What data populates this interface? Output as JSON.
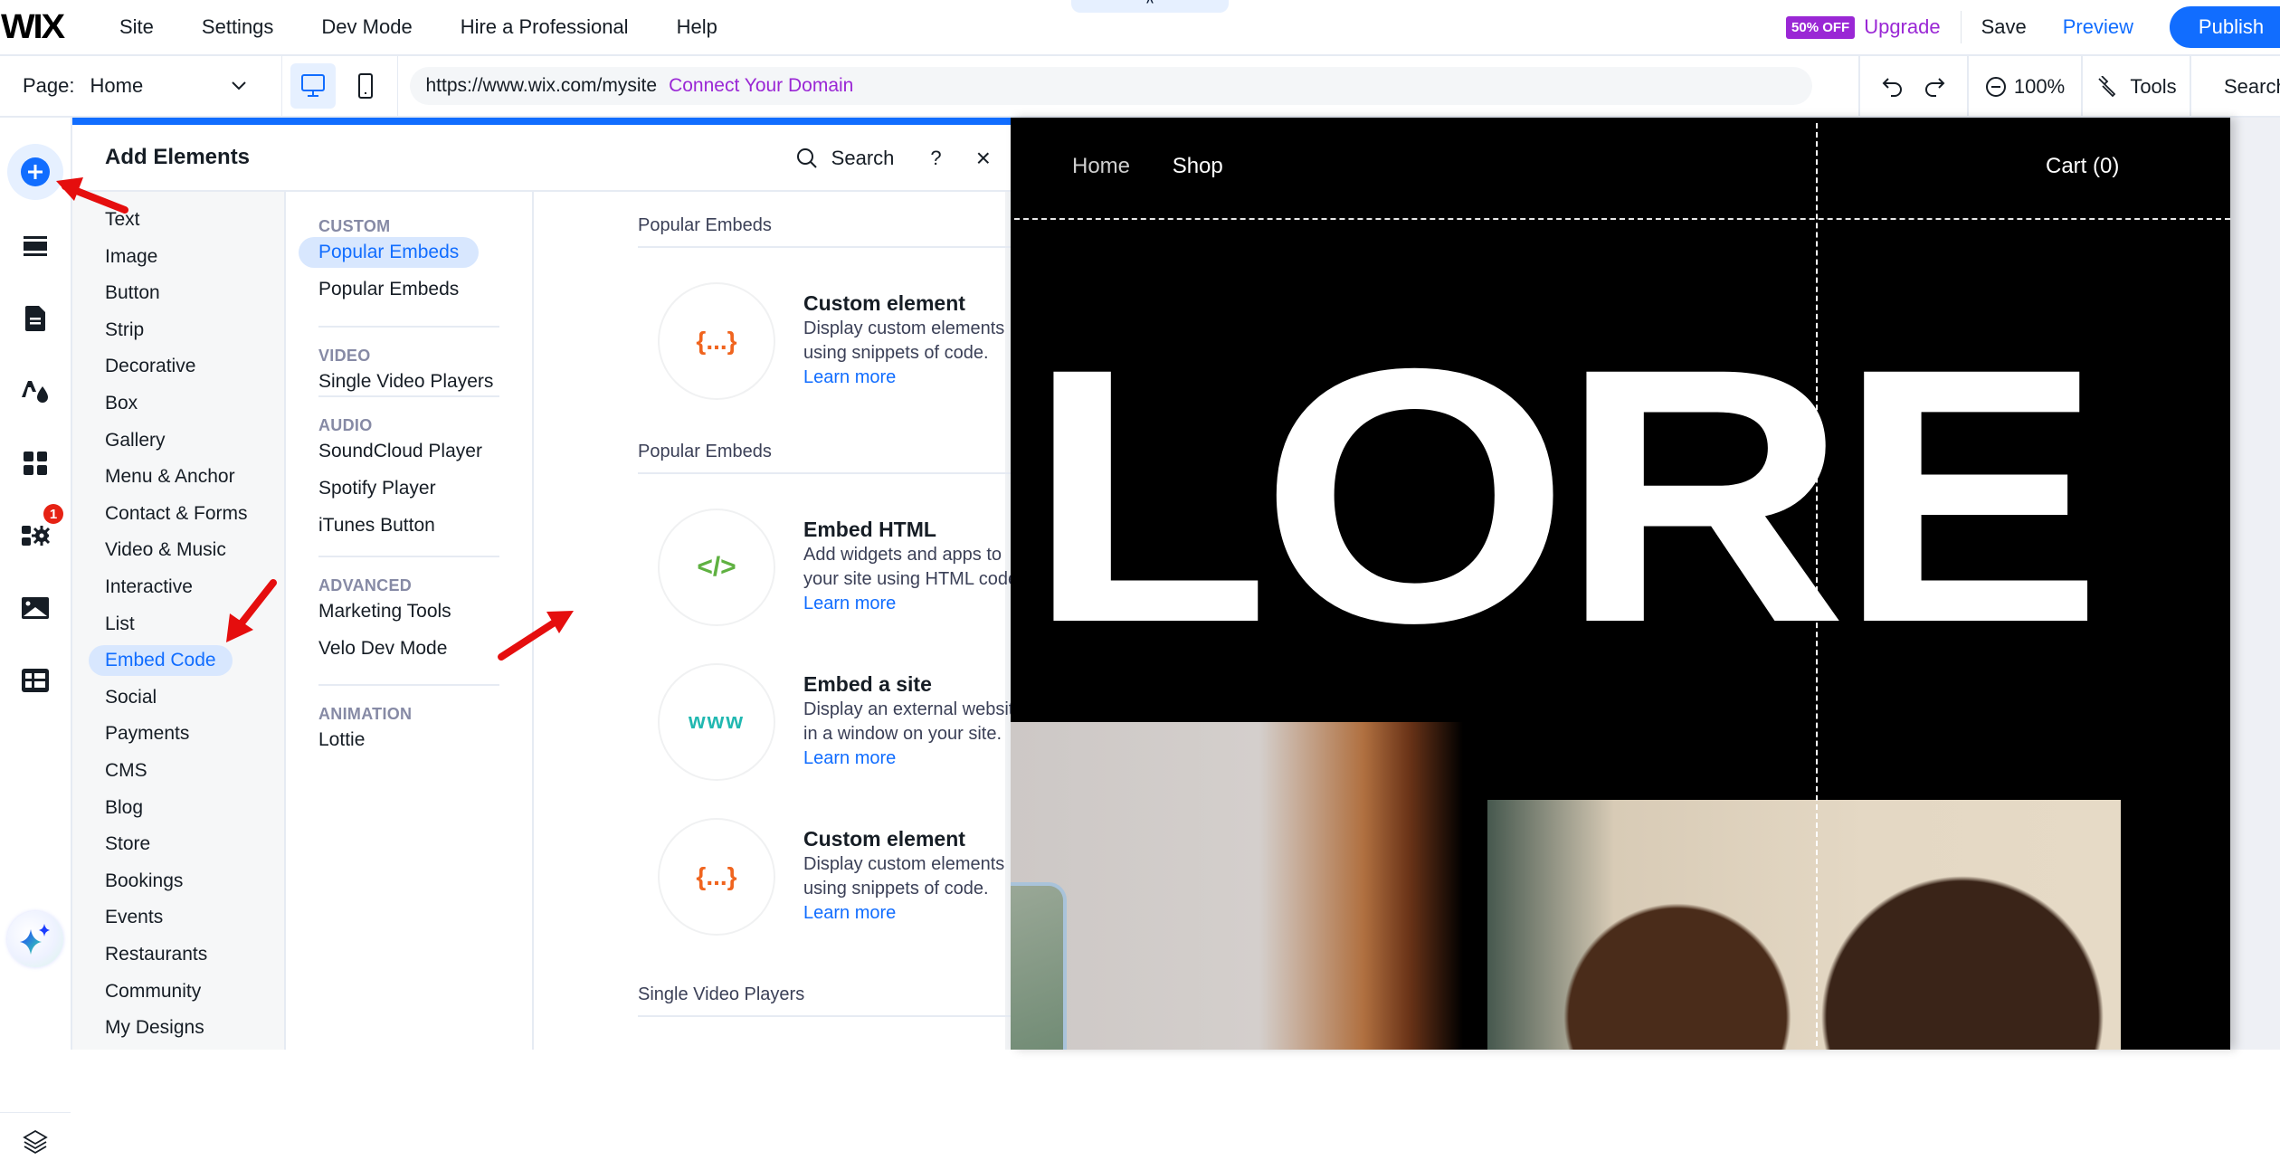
{
  "topbar": {
    "logo": "WIX",
    "menu": [
      "Site",
      "Settings",
      "Dev Mode",
      "Hire a Professional",
      "Help"
    ],
    "collapse_icon": "chevron-up-icon",
    "discount_badge": "50% OFF",
    "upgrade": "Upgrade",
    "save": "Save",
    "preview": "Preview",
    "publish": "Publish"
  },
  "secondbar": {
    "page_label": "Page:",
    "page_value": "Home",
    "url": "https://www.wix.com/mysite",
    "connect_domain": "Connect Your Domain",
    "zoom_level": "100%",
    "tools": "Tools",
    "search": "Search"
  },
  "rail": {
    "items": [
      "add-elements",
      "sections",
      "pages",
      "site-design",
      "add-apps",
      "business-apps",
      "media",
      "cms"
    ],
    "apps_badge": "1"
  },
  "panel": {
    "title": "Add Elements",
    "search": "Search",
    "help": "?",
    "close": "×",
    "categories": [
      "Text",
      "Image",
      "Button",
      "Strip",
      "Decorative",
      "Box",
      "Gallery",
      "Menu & Anchor",
      "Contact & Forms",
      "Video & Music",
      "Interactive",
      "List",
      "Embed Code",
      "Social",
      "Payments",
      "CMS",
      "Blog",
      "Store",
      "Bookings",
      "Events",
      "Restaurants",
      "Community",
      "My Designs"
    ],
    "active_category": "Embed Code",
    "subcategories": [
      {
        "heading": "CUSTOM",
        "items": [
          "Popular Embeds",
          "Popular Embeds"
        ]
      },
      {
        "heading": "VIDEO",
        "items": [
          "Single Video Players"
        ]
      },
      {
        "heading": "AUDIO",
        "items": [
          "SoundCloud Player",
          "Spotify Player",
          "iTunes Button"
        ]
      },
      {
        "heading": "ADVANCED",
        "items": [
          "Marketing Tools",
          "Velo Dev Mode"
        ]
      },
      {
        "heading": "ANIMATION",
        "items": [
          "Lottie"
        ]
      }
    ],
    "sections": [
      {
        "title": "Popular Embeds",
        "cards": [
          {
            "icon_text": "{...}",
            "title": "Custom element",
            "desc": "Display custom elements using snippets of code.",
            "link": "Learn more"
          }
        ]
      },
      {
        "title": "Popular Embeds",
        "cards": [
          {
            "icon_text": "</>",
            "title": "Embed HTML",
            "desc": "Add widgets and apps to your site using HTML code.",
            "link": "Learn more"
          },
          {
            "icon_text": "www",
            "title": "Embed a site",
            "desc": "Display an external website in a window on your site.",
            "link": "Learn more"
          },
          {
            "icon_text": "{...}",
            "title": "Custom element",
            "desc": "Display custom elements using snippets of code.",
            "link": "Learn more"
          }
        ]
      },
      {
        "title": "Single Video Players",
        "cards": []
      }
    ]
  },
  "site": {
    "nav": [
      "Home",
      "Shop"
    ],
    "cart": "Cart (0)",
    "hero_text": "LORE"
  },
  "colors": {
    "accent": "#116dff",
    "upgrade_purple": "#9a27d5",
    "active_bg": "#d8e7fe",
    "badge_red": "#e62214",
    "embed_orange": "#f0641e",
    "embed_green": "#5fb141",
    "embed_teal": "#21b8b1"
  }
}
